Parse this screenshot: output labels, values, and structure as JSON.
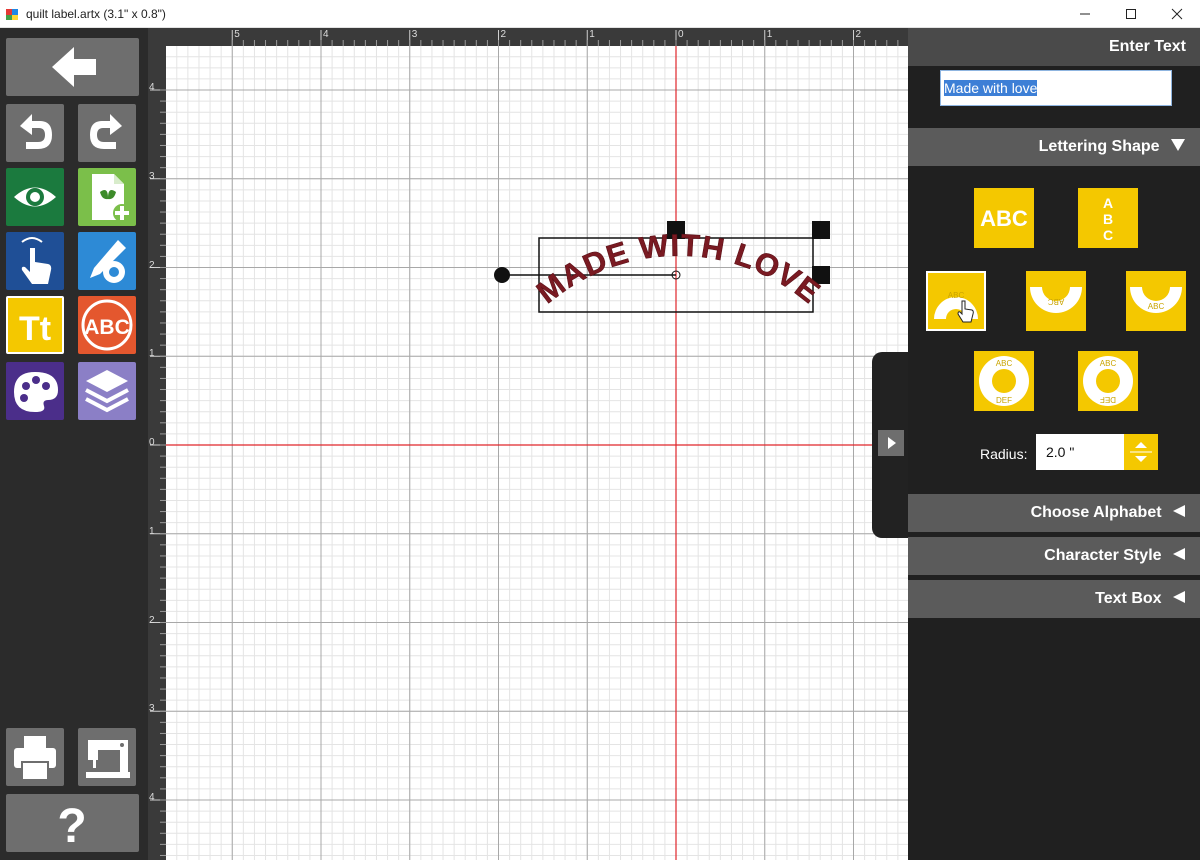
{
  "window": {
    "title": "quilt label.artx (3.1\" x 0.8\")"
  },
  "toolbar": {
    "items": [
      "back-arrow-icon",
      "undo-icon",
      "redo-icon",
      "eye-icon",
      "new-design-icon",
      "select-pointer-icon",
      "edit-settings-icon",
      "text-tool-icon",
      "monogram-icon",
      "palette-icon",
      "layers-icon",
      "print-icon",
      "sewing-machine-icon",
      "help-icon"
    ],
    "text_tool_glyph": "Tt",
    "monogram_glyph": "ABC",
    "help_glyph": "?"
  },
  "rulers": {
    "top_labels": [
      "5",
      "4",
      "3",
      "2",
      "1",
      "0",
      "1",
      "2"
    ],
    "left_labels": [
      "4",
      "3",
      "2",
      "1",
      "0",
      "1",
      "2",
      "3",
      "4"
    ]
  },
  "design": {
    "text": "MADE WITH LOVE",
    "thread_color": "#7a1a22"
  },
  "panel": {
    "enter_text_title": "Enter Text",
    "text_value": "Made with love",
    "lettering_shape_title": "Lettering Shape",
    "shape_labels": {
      "straight": "ABC",
      "arc_sample": "ABC",
      "circle_top": "ABC",
      "circle_bottom": "DEF"
    },
    "radius_label": "Radius:",
    "radius_value": "2.0 \"",
    "sections": [
      "Choose Alphabet",
      "Character Style",
      "Text Box"
    ]
  },
  "colors": {
    "accent_yellow": "#f4c800",
    "guide_red": "#e0262b",
    "panel_header": "#5b5b5b"
  }
}
